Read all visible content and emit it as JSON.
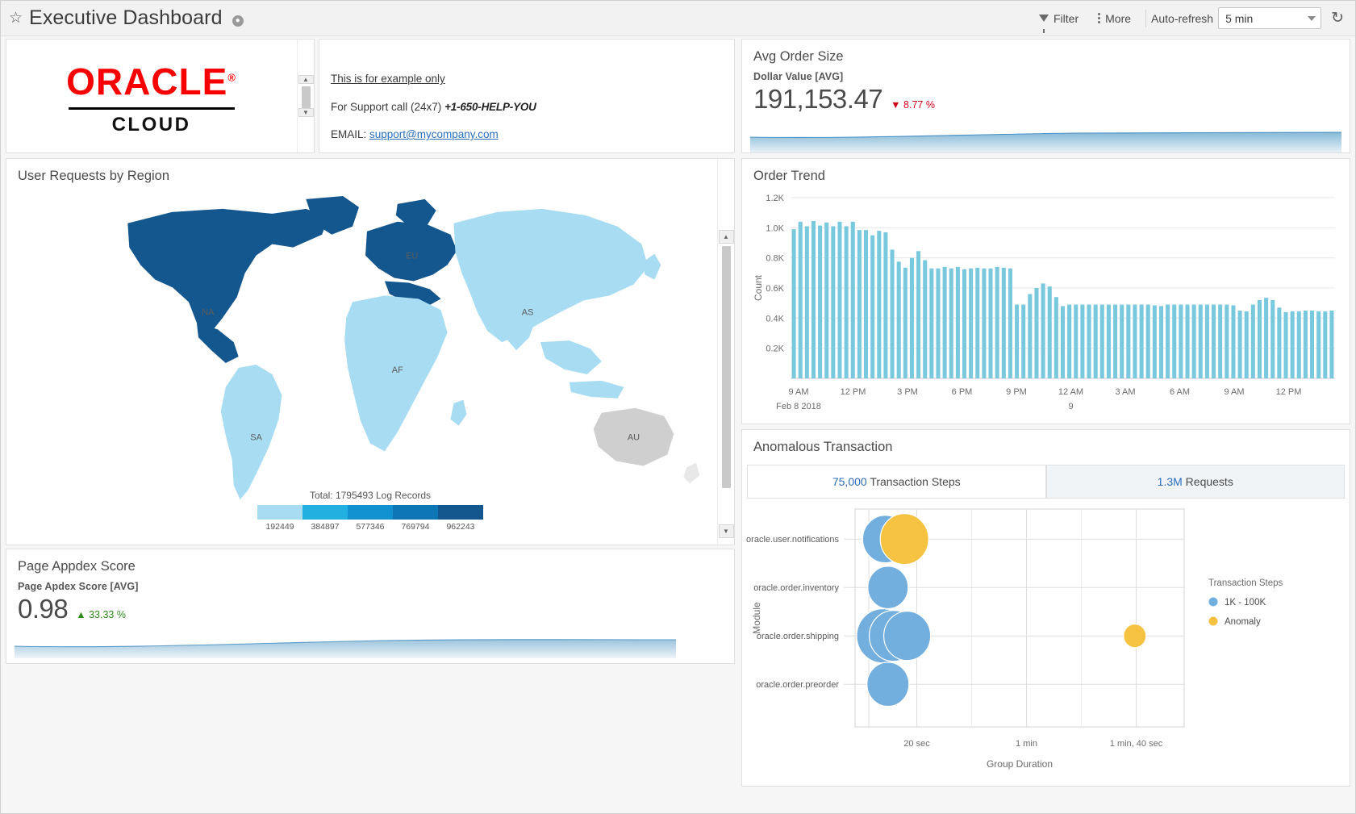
{
  "header": {
    "title": "Executive Dashboard",
    "star_icon": "star-outline-icon",
    "info_icon": "info-icon",
    "filter_label": "Filter",
    "more_label": "More",
    "autorefresh_label": "Auto-refresh",
    "autorefresh_value": "5 min",
    "refresh_icon": "refresh-icon"
  },
  "logo_card": {
    "brand": "ORACLE",
    "registered": "®",
    "sub": "CLOUD",
    "brand_color": "#f80000"
  },
  "support_card": {
    "heading": "This is for example only",
    "call_prefix": "For Support call  (24x7) ",
    "phone": "+1-650-HELP-YOU",
    "email_prefix": "EMAIL: ",
    "email": "support@mycompany.com"
  },
  "avg_order_size": {
    "title": "Avg Order Size",
    "metric_label": "Dollar Value [AVG]",
    "value": "191,153.47",
    "delta": "8.77 %",
    "delta_direction": "down",
    "delta_color": "#d0021b"
  },
  "page_appdex": {
    "title": "Page Appdex Score",
    "metric_label": "Page Apdex Score [AVG]",
    "value": "0.98",
    "delta": "33.33 %",
    "delta_direction": "up",
    "delta_color": "#2e8b1e"
  },
  "map_card": {
    "title": "User Requests by Region",
    "total_label": "Total: 1795493 Log Records",
    "regions": [
      "NA",
      "EU",
      "AS",
      "AF",
      "SA",
      "AU"
    ],
    "legend_ticks": [
      "192449",
      "384897",
      "577346",
      "769794",
      "962243"
    ],
    "legend_colors": [
      "#a7dcf2",
      "#22b0e0",
      "#1191cf",
      "#0d77b5",
      "#14578e"
    ]
  },
  "order_trend": {
    "title": "Order Trend"
  },
  "anomalous": {
    "title": "Anomalous Transaction",
    "tab_active": {
      "count": "75,000",
      "label": " Transaction Steps"
    },
    "tab_inactive": {
      "count": "1.3M",
      "label": " Requests"
    }
  },
  "chart_data": [
    {
      "type": "bar",
      "title": "Order Trend",
      "xlabel": "",
      "ylabel": "Count",
      "ylim": [
        0,
        1200
      ],
      "yticks": [
        200,
        400,
        600,
        800,
        1000,
        1200
      ],
      "ytick_labels": [
        "0.2K",
        "0.4K",
        "0.6K",
        "0.8K",
        "1.0K",
        "1.2K"
      ],
      "xtick_labels": [
        "9 AM",
        "12 PM",
        "3 PM",
        "6 PM",
        "9 PM",
        "12 AM",
        "3 AM",
        "6 AM",
        "9 AM",
        "12 PM"
      ],
      "xtick_sublabels": [
        "Feb 8 2018",
        "",
        "",
        "",
        "",
        "9",
        "",
        "",
        "",
        ""
      ],
      "grid": true,
      "bar_color": "#79c9de",
      "values": [
        990,
        1040,
        1010,
        1045,
        1015,
        1035,
        1010,
        1040,
        1010,
        1040,
        985,
        985,
        950,
        980,
        970,
        855,
        775,
        735,
        800,
        845,
        785,
        730,
        730,
        740,
        730,
        740,
        725,
        730,
        735,
        730,
        730,
        740,
        735,
        730,
        490,
        490,
        560,
        600,
        630,
        610,
        540,
        480,
        490,
        490,
        490,
        490,
        490,
        490,
        490,
        490,
        490,
        490,
        490,
        490,
        490,
        485,
        480,
        490,
        490,
        490,
        490,
        490,
        490,
        490,
        490,
        490,
        490,
        485,
        450,
        445,
        490,
        520,
        535,
        520,
        470,
        440,
        445,
        445,
        450,
        450,
        445,
        445,
        450
      ]
    },
    {
      "type": "scatter",
      "title": "Anomalous Transaction",
      "xlabel": "Group Duration",
      "ylabel": "Module",
      "categories": [
        "oracle.user.notifications",
        "oracle.order.inventory",
        "oracle.order.shipping",
        "oracle.order.preorder"
      ],
      "xtick_labels": [
        "20 sec",
        "1 min",
        "1 min, 40 sec"
      ],
      "legend_title": "Transaction Steps",
      "legend": [
        {
          "label": "1K - 100K",
          "color": "#72aede"
        },
        {
          "label": "Anomaly",
          "color": "#f5c242"
        }
      ],
      "points": [
        {
          "module": "oracle.user.notifications",
          "x": 11,
          "r": 28,
          "series": "1K - 100K"
        },
        {
          "module": "oracle.user.notifications",
          "x": 18,
          "r": 30,
          "series": "Anomaly"
        },
        {
          "module": "oracle.order.inventory",
          "x": 12,
          "r": 25,
          "series": "1K - 100K"
        },
        {
          "module": "oracle.order.shipping",
          "x": 10,
          "r": 32,
          "series": "1K - 100K"
        },
        {
          "module": "oracle.order.shipping",
          "x": 14,
          "r": 30,
          "series": "1K - 100K"
        },
        {
          "module": "oracle.order.shipping",
          "x": 19,
          "r": 29,
          "series": "1K - 100K"
        },
        {
          "module": "oracle.order.shipping",
          "x": 102,
          "r": 14,
          "series": "Anomaly"
        },
        {
          "module": "oracle.order.preorder",
          "x": 12,
          "r": 26,
          "series": "1K - 100K"
        }
      ]
    }
  ]
}
